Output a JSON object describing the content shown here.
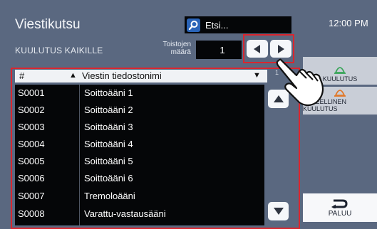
{
  "header": {
    "title": "Viestikutsu",
    "subtitle": "KUULUTUS KAIKILLE",
    "search_label": "Etsi...",
    "clock": "12:00 PM"
  },
  "repeat": {
    "label_line1": "Toistojen",
    "label_line2": "määrä",
    "value": "1"
  },
  "table": {
    "col_number": "#",
    "col_name": "Viestin tiedostonimi",
    "rows": [
      {
        "id": "S0001",
        "name": "Soittoääni 1"
      },
      {
        "id": "S0002",
        "name": "Soittoääni 2"
      },
      {
        "id": "S0003",
        "name": "Soittoääni 3"
      },
      {
        "id": "S0004",
        "name": "Soittoääni 4"
      },
      {
        "id": "S0005",
        "name": "Soittoääni 5"
      },
      {
        "id": "S0006",
        "name": "Soittoääni 6"
      },
      {
        "id": "S0007",
        "name": "Tremoloääni"
      },
      {
        "id": "S0008",
        "name": "Varattu-vastausääni"
      }
    ]
  },
  "sidebar": {
    "announce_label": "KUULUTUS",
    "urgent_label": "KIIREELLINEN KUULUTUS",
    "back_label": "PALUU"
  },
  "colors": {
    "background": "#5a6880",
    "highlight": "#d9262f",
    "icon_green": "#3aa55a",
    "icon_orange": "#e07a2c"
  },
  "icons": [
    "search-icon",
    "arrow-left-icon",
    "arrow-right-icon",
    "sort-up-icon",
    "dropdown-icon",
    "scroll-up-icon",
    "scroll-down-icon",
    "announce-icon",
    "urgent-icon",
    "return-icon",
    "pointing-hand-icon"
  ]
}
